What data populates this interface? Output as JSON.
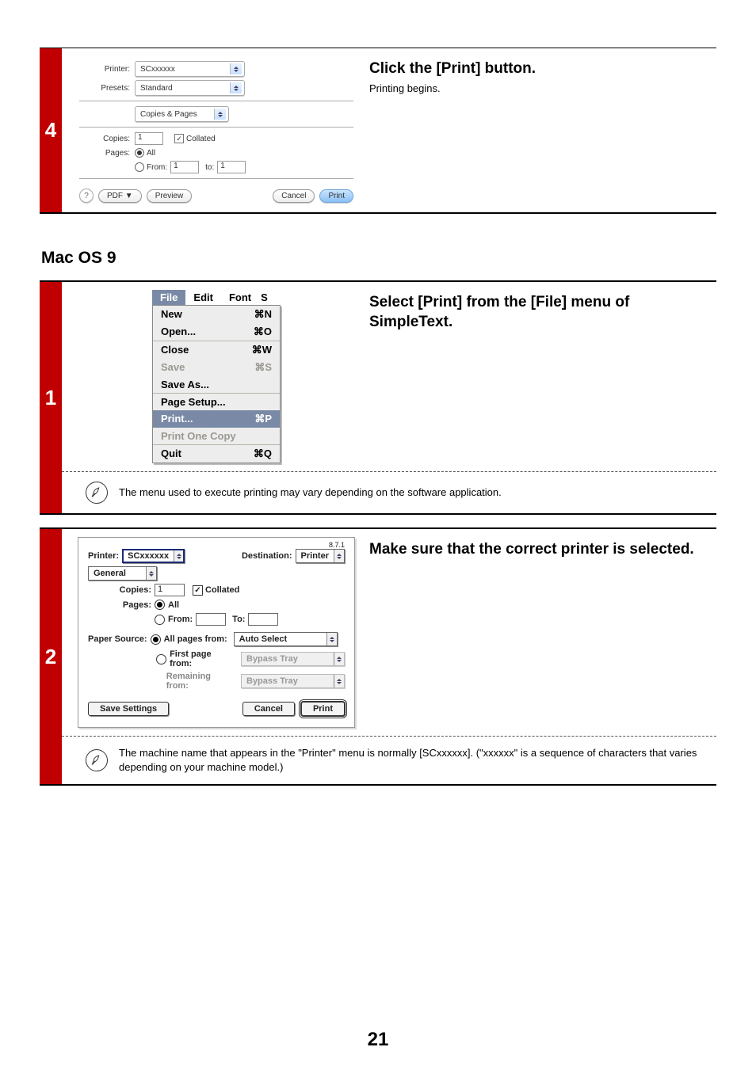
{
  "step4": {
    "number": "4",
    "title": "Click the [Print] button.",
    "sub": "Printing begins.",
    "dlg": {
      "printer_lbl": "Printer:",
      "printer_val": "SCxxxxxx",
      "presets_lbl": "Presets:",
      "presets_val": "Standard",
      "panel_val": "Copies & Pages",
      "copies_lbl": "Copies:",
      "copies_val": "1",
      "collated": "Collated",
      "pages_lbl": "Pages:",
      "pages_all": "All",
      "pages_from_lbl": "From:",
      "pages_from": "1",
      "pages_to_lbl": "to:",
      "pages_to": "1",
      "help": "?",
      "pdf": "PDF ▼",
      "preview": "Preview",
      "cancel": "Cancel",
      "print": "Print"
    }
  },
  "sectionHeading": "Mac OS 9",
  "step1": {
    "number": "1",
    "title": "Select [Print] from the [File] menu of SimpleText.",
    "menubar": {
      "file": "File",
      "edit": "Edit",
      "font": "Font",
      "size": "S"
    },
    "menu": {
      "new": "New",
      "new_k": "⌘N",
      "open": "Open...",
      "open_k": "⌘O",
      "close": "Close",
      "close_k": "⌘W",
      "save": "Save",
      "save_k": "⌘S",
      "saveas": "Save As...",
      "pagesetup": "Page Setup...",
      "print": "Print...",
      "print_k": "⌘P",
      "printone": "Print One Copy",
      "quit": "Quit",
      "quit_k": "⌘Q"
    },
    "note": "The menu used to execute printing may vary depending on the software application."
  },
  "step2": {
    "number": "2",
    "title": "Make sure that the correct printer is selected.",
    "dlg": {
      "version": "8.7.1",
      "printer_lbl": "Printer:",
      "printer_val": "SCxxxxxx",
      "dest_lbl": "Destination:",
      "dest_val": "Printer",
      "panel_val": "General",
      "copies_lbl": "Copies:",
      "copies_val": "1",
      "collated": "Collated",
      "pages_lbl": "Pages:",
      "pages_all": "All",
      "pages_from_lbl": "From:",
      "pages_to_lbl": "To:",
      "papersrc_lbl": "Paper Source:",
      "allpages_lbl": "All pages from:",
      "allpages_val": "Auto Select",
      "firstpage_lbl": "First page from:",
      "firstpage_val": "Bypass Tray",
      "remaining_lbl": "Remaining from:",
      "remaining_val": "Bypass Tray",
      "save": "Save Settings",
      "cancel": "Cancel",
      "print": "Print"
    },
    "note": "The machine name that appears in the \"Printer\" menu is normally [SCxxxxxx]. (\"xxxxxx\" is a sequence of characters that varies depending on your machine model.)"
  },
  "pageNumber": "21"
}
